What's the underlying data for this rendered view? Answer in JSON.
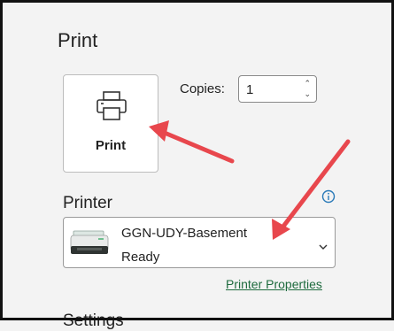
{
  "print": {
    "title": "Print",
    "button_label": "Print",
    "copies_label": "Copies:",
    "copies_value": "1"
  },
  "printer": {
    "section_label": "Printer",
    "name": "GGN-UDY-Basement",
    "status": "Ready",
    "properties_link": "Printer Properties"
  },
  "settings": {
    "section_label": "Settings"
  },
  "colors": {
    "accent": "#1e6b3e",
    "annotation_arrow": "#e8474d",
    "info_icon": "#2a7ab8"
  }
}
